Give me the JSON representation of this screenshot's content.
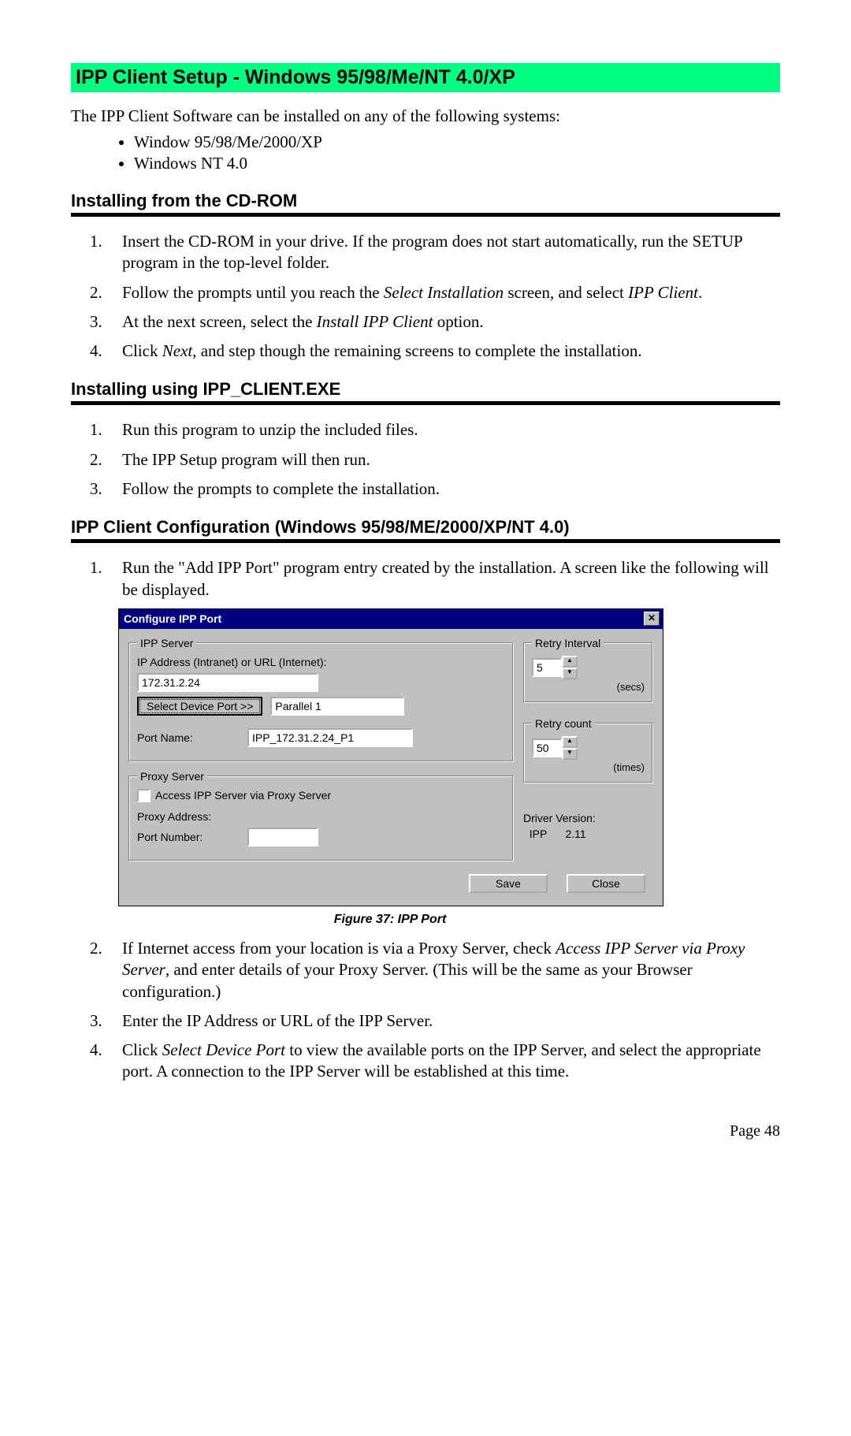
{
  "heading_main": "IPP Client Setup - Windows 95/98/Me/NT 4.0/XP",
  "intro": "The IPP Client Software can be installed on any of the following systems:",
  "os_bullets": [
    "Window 95/98/Me/2000/XP",
    "Windows NT 4.0"
  ],
  "h_cdrom": "Installing from the CD-ROM",
  "cdrom_steps": {
    "s1": "Insert the CD-ROM in your drive. If the program does not start automatically, run the SETUP program in the top-level folder.",
    "s2_a": "Follow the prompts until you reach the ",
    "s2_i1": "Select Installation",
    "s2_b": " screen, and select ",
    "s2_i2": "IPP Client",
    "s2_c": ".",
    "s3_a": "At the next screen, select the ",
    "s3_i": "Install IPP Client",
    "s3_b": " option.",
    "s4_a": "Click ",
    "s4_i": "Next",
    "s4_b": ", and step though the remaining screens to complete the installation."
  },
  "h_exe": "Installing using IPP_CLIENT.EXE",
  "exe_steps": [
    "Run this program to unzip the included files.",
    "The IPP Setup program will then run.",
    "Follow the prompts to complete the installation."
  ],
  "h_config": "IPP Client Configuration (Windows 95/98/ME/2000/XP/NT 4.0)",
  "config_step1": "Run the \"Add IPP Port\" program entry created by the installation. A screen like the following will be displayed.",
  "dialog": {
    "title": "Configure IPP Port",
    "close_x": "✕",
    "grp_ipp": "IPP Server",
    "lbl_ip": "IP Address (Intranet) or URL (Internet):",
    "val_ip": "172.31.2.24",
    "btn_select": "Select Device Port >>",
    "val_device": "Parallel 1",
    "lbl_portname": "Port Name:",
    "val_portname": "IPP_172.31.2.24_P1",
    "grp_retry_int": "Retry Interval",
    "val_retry_int": "5",
    "unit_secs": "(secs)",
    "grp_retry_cnt": "Retry count",
    "val_retry_cnt": "50",
    "unit_times": "(times)",
    "grp_proxy": "Proxy Server",
    "chk_proxy": "Access IPP Server via Proxy Server",
    "lbl_proxy_addr": "Proxy Address:",
    "lbl_proxy_port": "Port Number:",
    "lbl_driver": "Driver Version:",
    "val_driver_name": "IPP",
    "val_driver_ver": "2.11",
    "btn_save": "Save",
    "btn_close": "Close"
  },
  "caption": "Figure 37: IPP Port",
  "config_step2_a": "If Internet access from your location is via a Proxy Server, check ",
  "config_step2_i": "Access IPP Server via Proxy Server",
  "config_step2_b": ", and enter details of your Proxy Server. (This will be the same as your Browser configuration.)",
  "config_step3": "Enter the IP Address or URL of the IPP Server.",
  "config_step4_a": "Click ",
  "config_step4_i": "Select Device Port",
  "config_step4_b": " to view the available ports on the IPP Server, and select the appropriate port. A connection to the IPP Server will be established at this time.",
  "page_num": "Page 48"
}
